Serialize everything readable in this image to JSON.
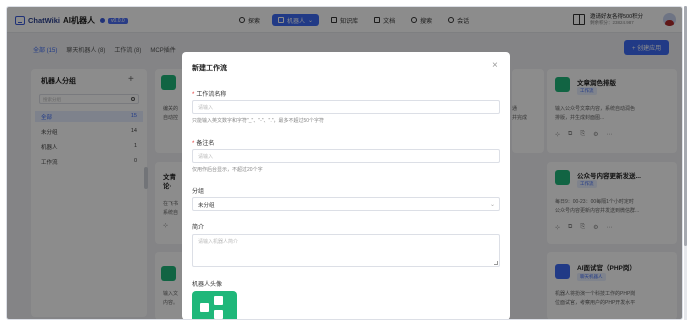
{
  "header": {
    "app_name": "ChatWiki",
    "app_title": "AI机器人",
    "version": "v0.0.0",
    "nav": [
      {
        "label": "探索",
        "icon": "compass-icon"
      },
      {
        "label": "机器人",
        "icon": "robot-icon"
      },
      {
        "label": "知识库",
        "icon": "book-icon"
      },
      {
        "label": "文档",
        "icon": "document-icon"
      },
      {
        "label": "搜索",
        "icon": "search-icon"
      },
      {
        "label": "会话",
        "icon": "chat-icon"
      }
    ],
    "promo_title": "邀请好友各得500积分",
    "promo_sub": "剩余积分：23824.987"
  },
  "tabs": [
    {
      "label": "全部 (15)"
    },
    {
      "label": "聊天机器人 (8)"
    },
    {
      "label": "工作流 (8)"
    },
    {
      "label": "MCP插件"
    }
  ],
  "create_button": "+ 创建应用",
  "sidebar": {
    "title": "机器人分组",
    "search_placeholder": "搜索分组",
    "groups": [
      {
        "name": "全部",
        "count": "15"
      },
      {
        "name": "未分组",
        "count": "14"
      },
      {
        "name": "机器人",
        "count": "1"
      },
      {
        "name": "工作流",
        "count": "0"
      }
    ]
  },
  "cards": {
    "left_top_text": [
      "编关的",
      "自动控"
    ],
    "left_mid_title": "文青",
    "left_mid_sub": "论·",
    "left_mid_text": [
      "在飞书",
      "系统自"
    ],
    "left_bot_text": [
      "输入文",
      "内容。"
    ],
    "mid_right_text": [
      "通",
      "并完成"
    ],
    "right1": {
      "title": "文章润色排版",
      "tag": "工作流",
      "desc1": "输入公众号文章内容，系统自动润色",
      "desc2": "排版，并生成封面图..."
    },
    "right2": {
      "title": "公众号内容更新发送...",
      "tag": "工作流",
      "desc1": "每日9：00-23：00每隔1个小时定时",
      "desc2": "公众号内容更新内容并发送到微信群..."
    },
    "right3": {
      "title": "AI面试官（PHP岗）",
      "tag": "聊天机器人",
      "desc1": "机器人将扮演一个科技工作的PHP岗",
      "desc2": "位面试官，考察用户的PHP开发水平"
    }
  },
  "modal": {
    "title": "新建工作流",
    "name_label": "工作流名称",
    "name_placeholder": "请输入",
    "name_hint": "只能输入英文数字和字符\"_\"、\"-\"、\".\"，最多不超过50个字符",
    "remark_label": "备注名",
    "remark_placeholder": "请输入",
    "remark_hint": "仅用作后台显示，不超过20个字",
    "group_label": "分组",
    "group_value": "未分组",
    "intro_label": "简介",
    "intro_placeholder": "请输入机器人简介",
    "avatar_label": "机器人头像"
  },
  "colors": {
    "accent": "#3d6bf5",
    "bot_green": "#1fb77a"
  }
}
